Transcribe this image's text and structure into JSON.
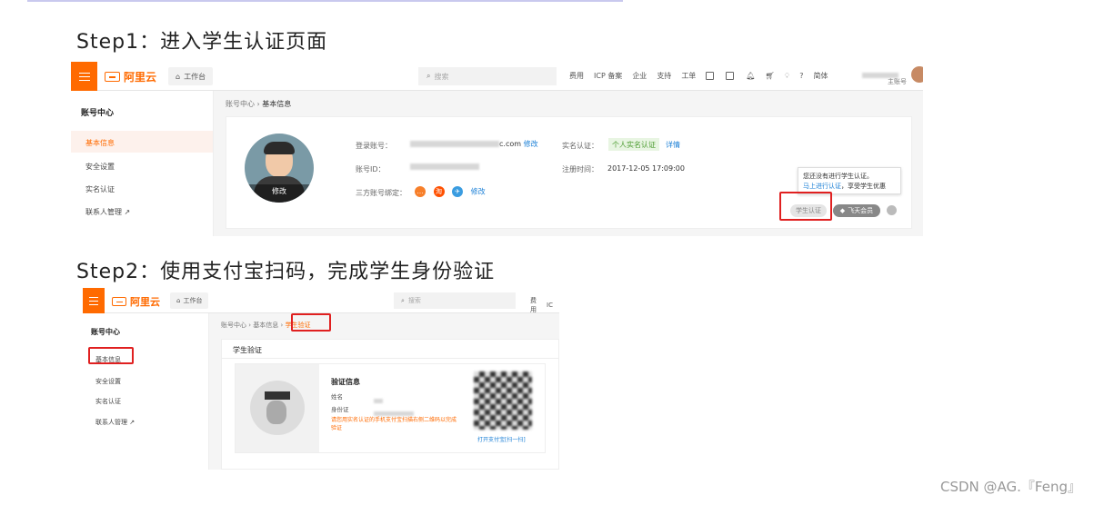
{
  "step1_title": "Step1：进入学生认证页面",
  "step2_title": "Step2：使用支付宝扫码，完成学生身份验证",
  "brand": "阿里云",
  "workbench": "工作台",
  "search_placeholder": "搜索",
  "nav": [
    "费用",
    "ICP 备案",
    "企业",
    "支持",
    "工单"
  ],
  "nav_lang": "简体",
  "account_role": "主账号",
  "sidebar": {
    "title": "账号中心",
    "items": [
      "基本信息",
      "安全设置",
      "实名认证",
      "联系人管理"
    ]
  },
  "shot1": {
    "breadcrumb": [
      "账号中心",
      "基本信息"
    ],
    "avatar_edit": "修改",
    "login_label": "登录账号：",
    "login_value_suffix": "c.com",
    "edit": "修改",
    "id_label": "账号ID：",
    "third_label": "三方账号绑定：",
    "realname_label": "实名认证：",
    "realname_badge": "个人实名认证",
    "realname_detail": "详情",
    "reg_label": "注册时间：",
    "reg_value": "2017-12-05 17:09:00",
    "tip_line1": "您还没有进行学生认证。",
    "tip_link": "马上进行认证",
    "tip_line2": "，享受学生优惠",
    "student_btn": "学生认证",
    "fly_btn": "飞天会员"
  },
  "shot2": {
    "breadcrumb": [
      "账号中心",
      "基本信息",
      "学生验证"
    ],
    "section_title": "学生验证",
    "info_title": "验证信息",
    "name_label": "姓名",
    "id_label": "身份证",
    "warn": "请您用实名认证的手机支付宝扫描右侧二维码以完成验证",
    "qr_link": "打开支付宝[扫一扫]"
  },
  "watermark": "CSDN @AG.『Feng』",
  "colors": {
    "brand": "#ff6a00",
    "highlight": "#e02020",
    "link": "#1a7fd6"
  }
}
